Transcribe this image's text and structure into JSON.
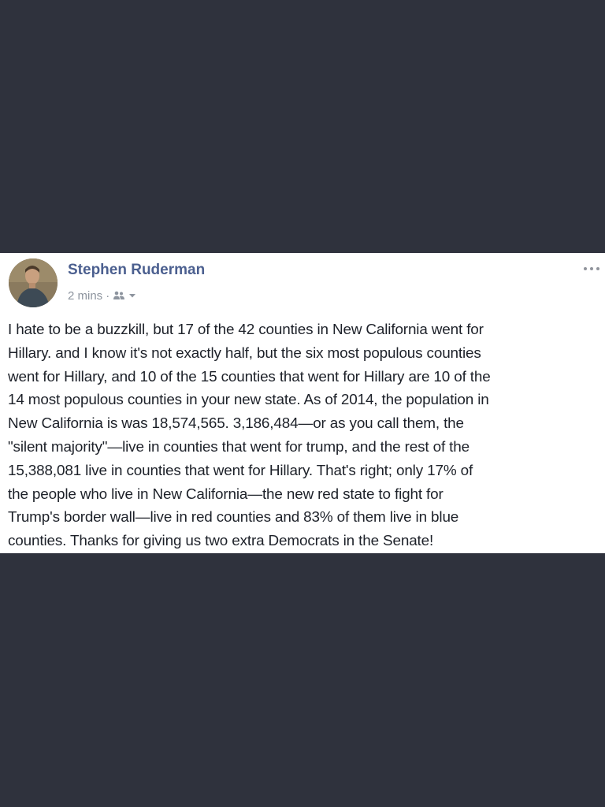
{
  "post": {
    "author": "Stephen Ruderman",
    "timestamp": "2 mins",
    "separator": "·",
    "audience_icon": "friends-icon",
    "body": "I hate to be a buzzkill, but 17 of the 42 counties in New California went for\nHillary. and I know it's not exactly half, but the six most populous counties\nwent for Hillary, and 10 of the 15 counties that went for Hillary are 10 of the\n14 most populous counties in your new state. As of 2014, the population in\nNew California is was 18,574,565. 3,186,484—or as you call them, the\n\"silent majority\"—live in counties that went for trump, and the rest of the\n15,388,081 live in counties that went for Hillary. That's right; only 17% of\nthe people who live in New California—the new red state to fight for\nTrump's border wall—live in red counties and 83% of them live in blue\ncounties. Thanks for giving us two extra Democrats in the Senate!"
  },
  "colors": {
    "page_background": "#2f323d",
    "card_background": "#ffffff",
    "author_name": "#4b5f8f",
    "meta_text": "#8d949e",
    "body_text": "#1d2129"
  },
  "icons": {
    "more": "more-options-icon",
    "chevron": "chevron-down-icon"
  }
}
